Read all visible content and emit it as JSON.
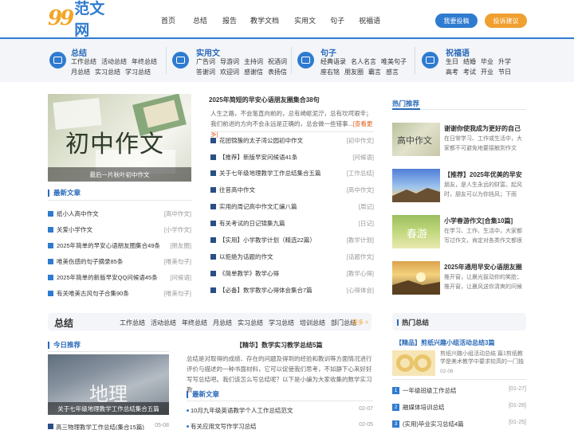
{
  "logo": {
    "num": "99",
    "name": "范文网"
  },
  "nav": [
    "首页",
    "总结",
    "报告",
    "教学文档",
    "实用文",
    "句子",
    "祝福语"
  ],
  "buttons": {
    "submit": "我要投稿",
    "suggest": "投诉建议"
  },
  "categories": [
    {
      "title": "总结",
      "icon": "summary-icon",
      "rows": [
        [
          "工作总结",
          "活动总结",
          "年终总结"
        ],
        [
          "月总结",
          "实习总结",
          "学习总结"
        ]
      ]
    },
    {
      "title": "实用文",
      "icon": "document-icon",
      "rows": [
        [
          "广告词",
          "导游词",
          "主持词",
          "祝酒词"
        ],
        [
          "答谢词",
          "欢迎词",
          "感谢信",
          "表扬信"
        ]
      ]
    },
    {
      "title": "句子",
      "icon": "sentence-icon",
      "rows": [
        [
          "经典语录",
          "名人名言",
          "唯美句子"
        ],
        [
          "座右铭",
          "朋友圈",
          "霸言",
          "感言"
        ]
      ]
    },
    {
      "title": "祝福语",
      "icon": "blessing-icon",
      "rows": [
        [
          "生日",
          "结婚",
          "毕业",
          "升学"
        ],
        [
          "高考",
          "考试",
          "开业",
          "节日"
        ]
      ]
    }
  ],
  "featured": {
    "big_text": "初中作文",
    "caption": "最后一片秋叶初中作文"
  },
  "latest": {
    "title": "最新文章",
    "items": [
      {
        "title": "纸小人高中作文",
        "tag": "[高中作文]"
      },
      {
        "title": "关爱小学作文",
        "tag": "[小学作文]"
      },
      {
        "title": "2025年简单的早安心语朋友圈集合49条",
        "tag": "[朋友圈]"
      },
      {
        "title": "唯美伤感的句子摘录85条",
        "tag": "[唯美句子]"
      },
      {
        "title": "2025年简单的新版早安QQ问候语45条",
        "tag": "[问候语]"
      },
      {
        "title": "有关唯美古风句子合集90条",
        "tag": "[唯美句子]"
      }
    ]
  },
  "headline": {
    "title": "2025年简短的早安心语朋友圈集合38句",
    "desc": "人生之路，不会笔直向前的，总有崎岖泥泞，总有坎坷艰辛；我们前进的方向不会永远是正确的，总会做一些错事...",
    "more": "[查看更多]"
  },
  "center_list": [
    {
      "title": "花团锦簇的太子湾公园初中作文",
      "tag": "[初中作文]"
    },
    {
      "title": "【推荐】新版早安问候语41条",
      "tag": "[问候语]"
    },
    {
      "title": "关于七年级地理教学工作总结集合五篇",
      "tag": "[工作总结]"
    },
    {
      "title": "往昔高中作文",
      "tag": "[高中作文]"
    },
    {
      "title": "实用的周记高中作文汇编八篇",
      "tag": "[周记]"
    },
    {
      "title": "有关考试的日记锦集九篇",
      "tag": "[日记]"
    },
    {
      "title": "【实用】小学教学计划（精选22篇）",
      "tag": "[教学计划]"
    },
    {
      "title": "以拒绝为话题的作文",
      "tag": "[话题作文]"
    },
    {
      "title": "《简单教学》教学心得",
      "tag": "[教学心得]"
    },
    {
      "title": "【必备】数学教学心得体会集合7篇",
      "tag": "[心得体会]"
    }
  ],
  "hot": {
    "title": "热门推荐",
    "items": [
      {
        "title": "谢谢你使我成为更好的自己",
        "desc": "在日常学习、工作或生活中，大家都不可避免地要接触到作文",
        "img_text": "高中作文"
      },
      {
        "title": "【推荐】2025年优美的早安",
        "desc": "朋友，是人生永远的财富。起风时，朋友可以为你挡风；下雨",
        "img_text": ""
      },
      {
        "title": "小学春游作文[合集10篇]",
        "desc": "在学习、工作、生活中，大家都写过作文，肯定对各类作文都很",
        "img_text": "春游"
      },
      {
        "title": "2025年通用早安心语朋友圈",
        "desc": "推开窗，让晨光拔动你的笑脸；推开窗，让晨风送你清爽的问候",
        "img_text": ""
      }
    ]
  },
  "summary_section": {
    "title": "总结",
    "links": [
      "工作总结",
      "活动总结",
      "年终总结",
      "月总结",
      "实习总结",
      "学习总结",
      "培训总结",
      "部门总结"
    ],
    "more": "更多 >"
  },
  "today": {
    "title": "今日推荐",
    "big_text": "地理",
    "caption": "关于七年级地理教学工作总结集合五篇",
    "row": "高三物理教学工作总结(集合15篇)",
    "row_date": "05-08"
  },
  "mid_article": {
    "title": "【精华】数学实习教学总结5篇",
    "desc": "总结是对取得的成绩、存在的问题及得到的经验和教训等方面情况进行评价与描述的一种书面材料，它可以促使我们思考，不如静下心来好好写写总结吧。我们该怎么写总结呢？以下是小编为大家收集的数学实习教"
  },
  "mid_news": {
    "title": "最新文章",
    "items": [
      {
        "title": "10月九年级英语教学个人工作总结范文",
        "date": "02-07"
      },
      {
        "title": "有关应用文写作学习总结",
        "date": "02-05"
      }
    ]
  },
  "reading": {
    "title": "热门总结",
    "feature_title": "【精品】剪纸兴趣小组活动总结3篇",
    "feature_desc": "剪纸兴趣小组活动总结 篇1剪纸教学是美术教学中要求较高的一门独",
    "feature_date": "02-06",
    "items": [
      {
        "n": "1",
        "title": "一年级班级工作总结",
        "date": "[01-27]"
      },
      {
        "n": "2",
        "title": "融媒体培训总结",
        "date": "[01-26]"
      },
      {
        "n": "3",
        "title": "(实用)毕业实习总结4篇",
        "date": "[01-25]"
      }
    ]
  }
}
